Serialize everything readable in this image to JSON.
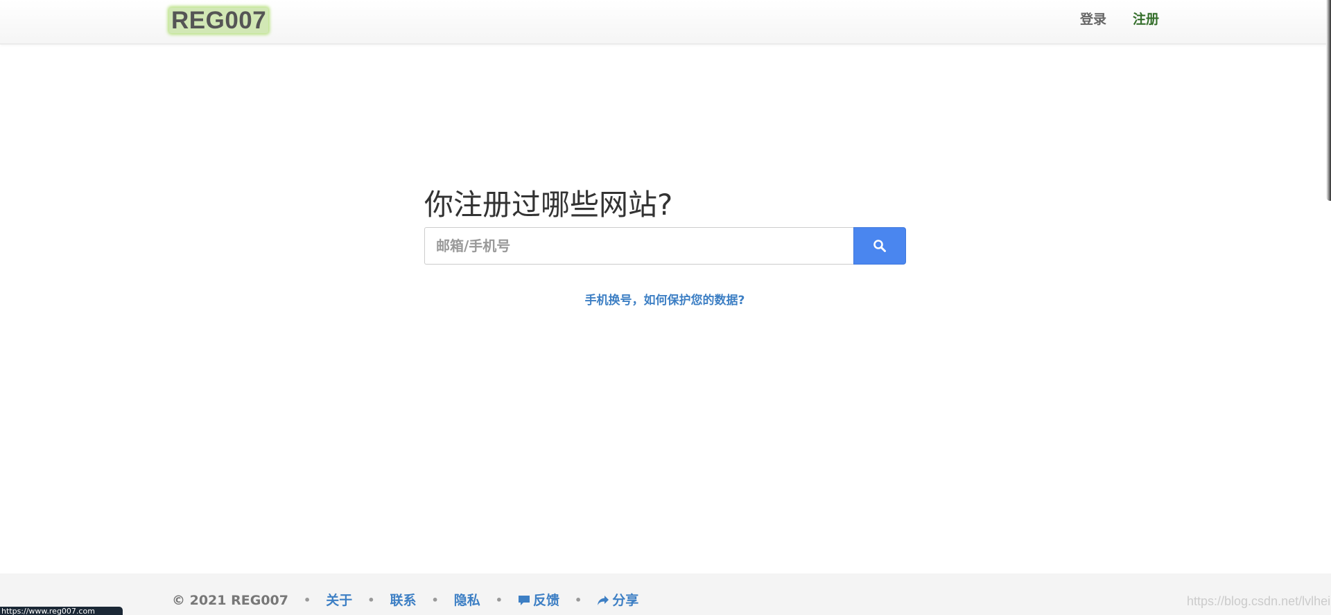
{
  "header": {
    "brand": "REG007",
    "login": "登录",
    "register": "注册"
  },
  "search": {
    "title": "你注册过哪些网站?",
    "placeholder": "邮箱/手机号",
    "button_icon": "search-icon"
  },
  "help_link": "手机换号，如何保护您的数据?",
  "footer": {
    "copyright": "© 2021 REG007",
    "separator": "•",
    "links": {
      "about": "关于",
      "contact": "联系",
      "privacy": "隐私",
      "feedback": "反馈",
      "share": "分享"
    },
    "feedback_icon": "comment-icon",
    "share_icon": "share-icon"
  },
  "status_bar": {
    "url": "https://www.reg007.com"
  },
  "watermark": "https://blog.csdn.net/lvlheike",
  "colors": {
    "brand_highlight": "#d2e8b5",
    "register_link": "#356f2c",
    "search_button": "#4a86ef",
    "link_blue": "#3d7fc4",
    "footer_bg": "#f4f4f4"
  }
}
